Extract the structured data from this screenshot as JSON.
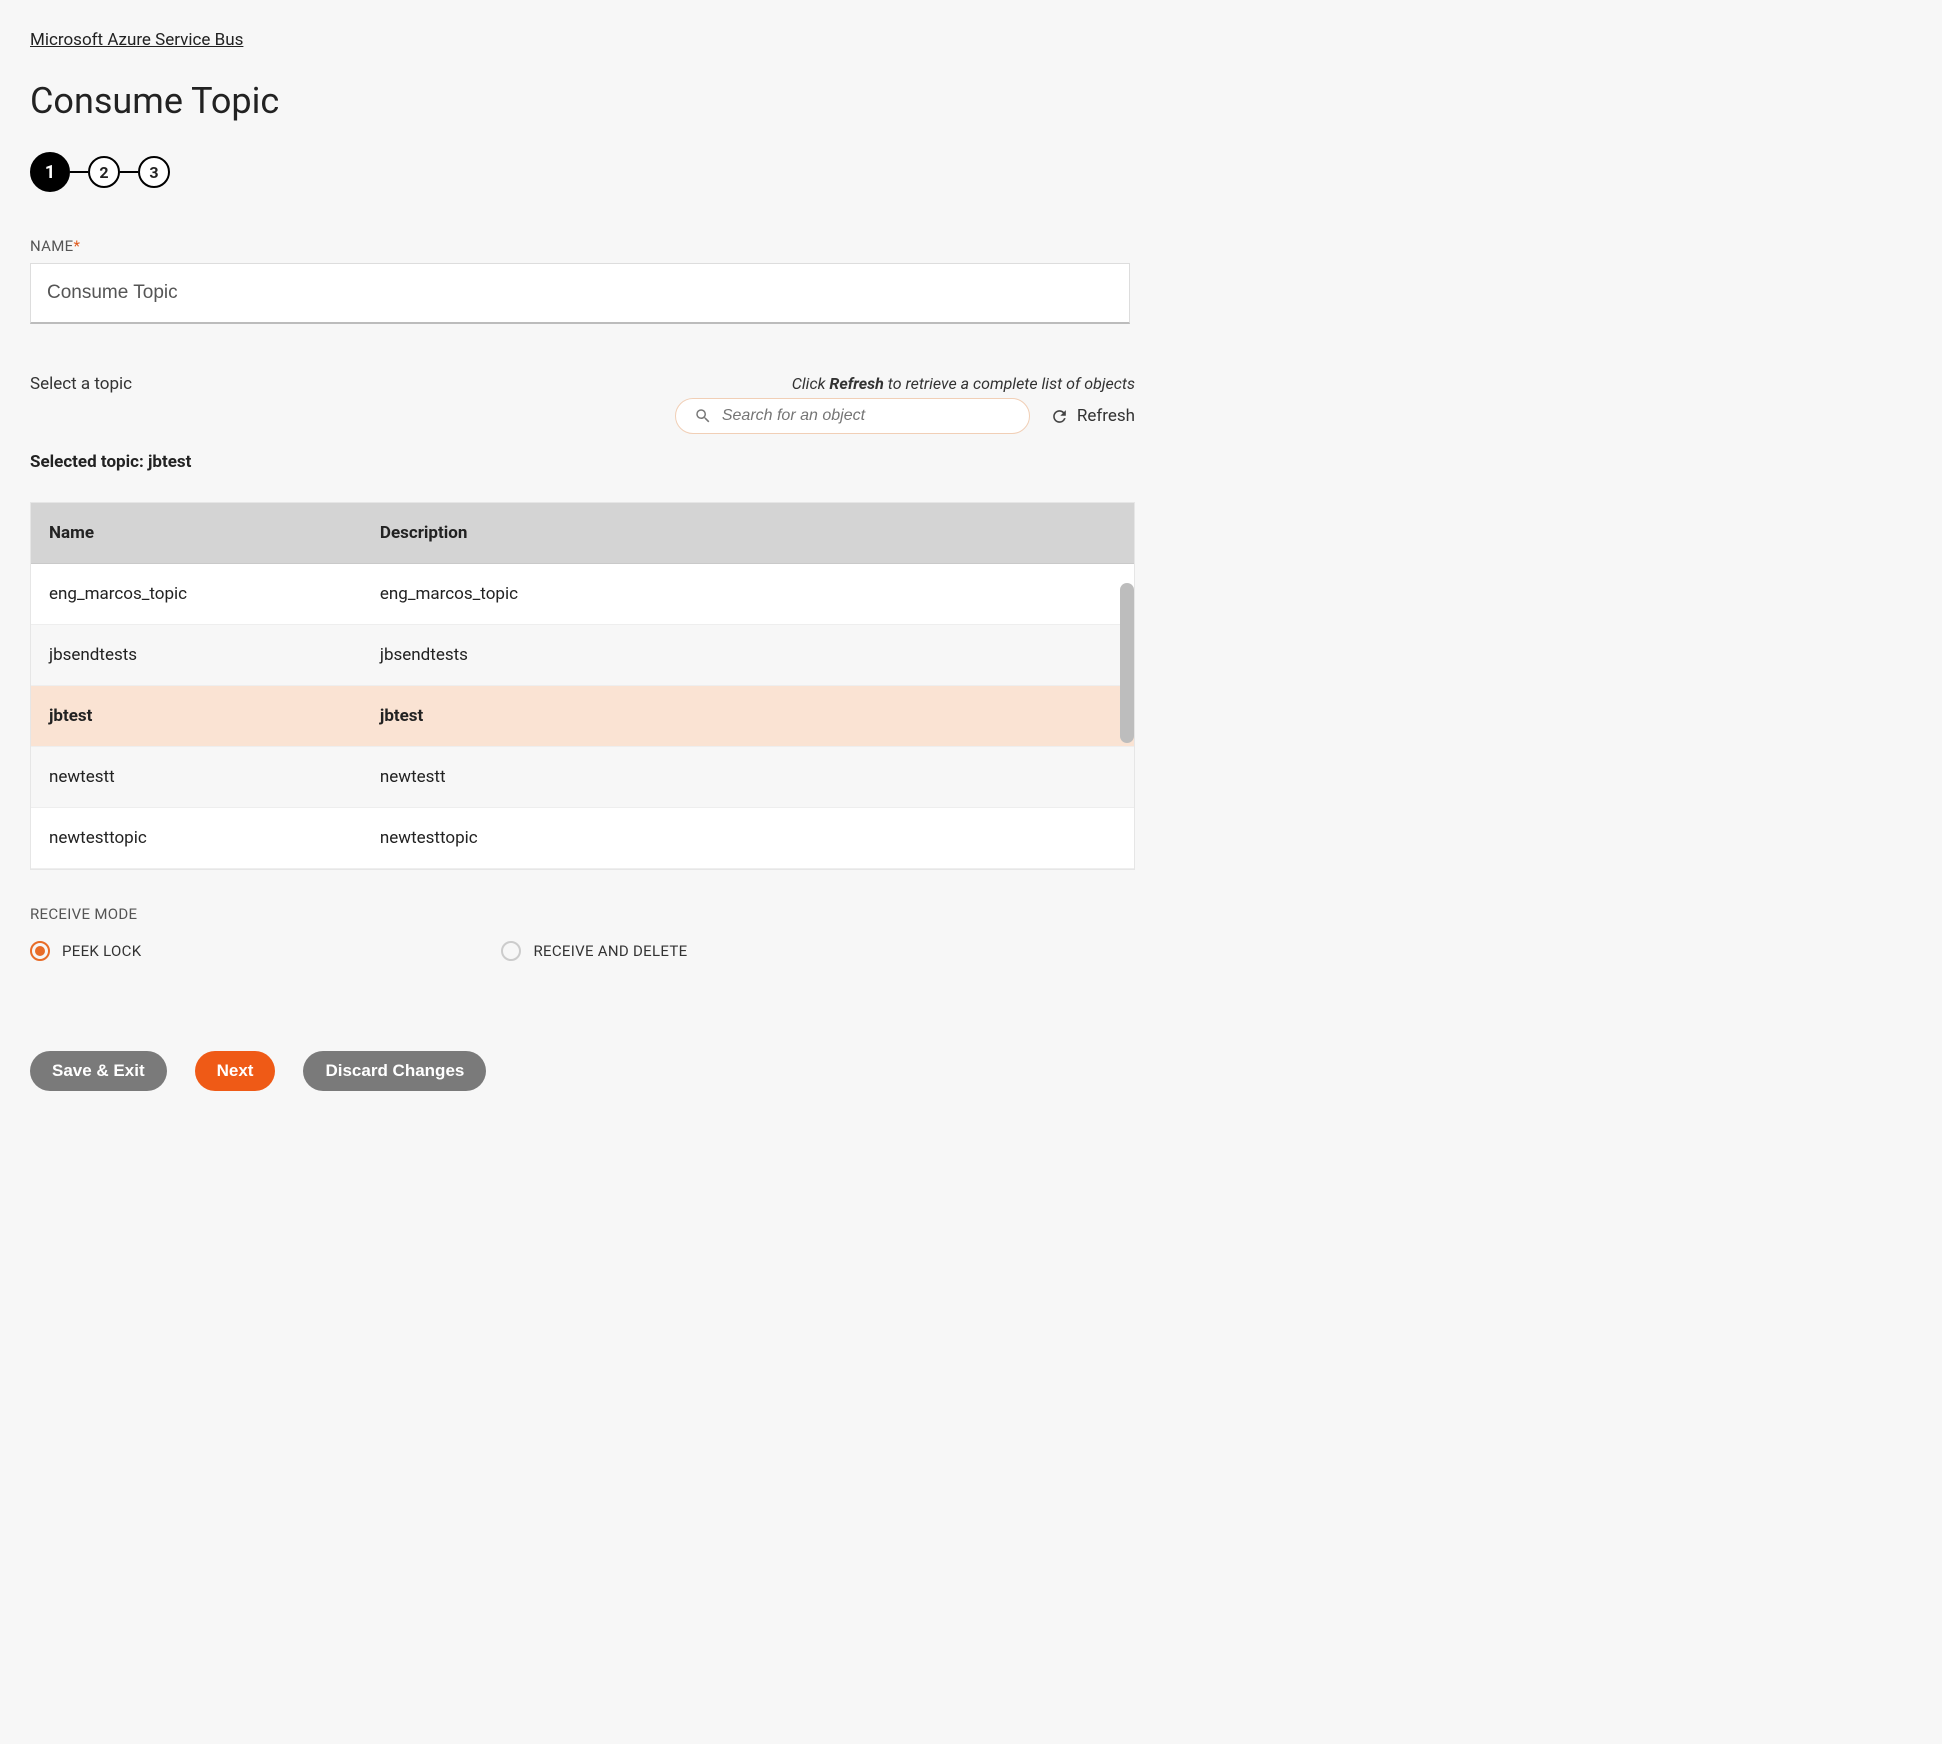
{
  "breadcrumb": "Microsoft Azure Service Bus",
  "page_title": "Consume Topic",
  "stepper": {
    "steps": [
      "1",
      "2",
      "3"
    ],
    "active": 0
  },
  "name_field": {
    "label": "NAME",
    "value": "Consume Topic"
  },
  "select_topic": {
    "label": "Select a topic",
    "selected_prefix": "Selected topic: ",
    "selected_value": "jbtest",
    "hint_prefix": "Click ",
    "hint_bold": "Refresh",
    "hint_suffix": " to retrieve a complete list of objects",
    "search_placeholder": "Search for an object",
    "refresh_label": "Refresh"
  },
  "table": {
    "headers": [
      "Name",
      "Description"
    ],
    "rows": [
      {
        "name": "eng_marcos_topic",
        "description": "eng_marcos_topic",
        "selected": false
      },
      {
        "name": "jbsendtests",
        "description": "jbsendtests",
        "selected": false
      },
      {
        "name": "jbtest",
        "description": "jbtest",
        "selected": true
      },
      {
        "name": "newtestt",
        "description": "newtestt",
        "selected": false
      },
      {
        "name": "newtesttopic",
        "description": "newtesttopic",
        "selected": false
      }
    ]
  },
  "receive_mode": {
    "label": "RECEIVE MODE",
    "options": [
      {
        "label": "PEEK LOCK",
        "checked": true
      },
      {
        "label": "RECEIVE AND DELETE",
        "checked": false
      }
    ]
  },
  "footer": {
    "save_exit": "Save & Exit",
    "next": "Next",
    "discard": "Discard Changes"
  }
}
